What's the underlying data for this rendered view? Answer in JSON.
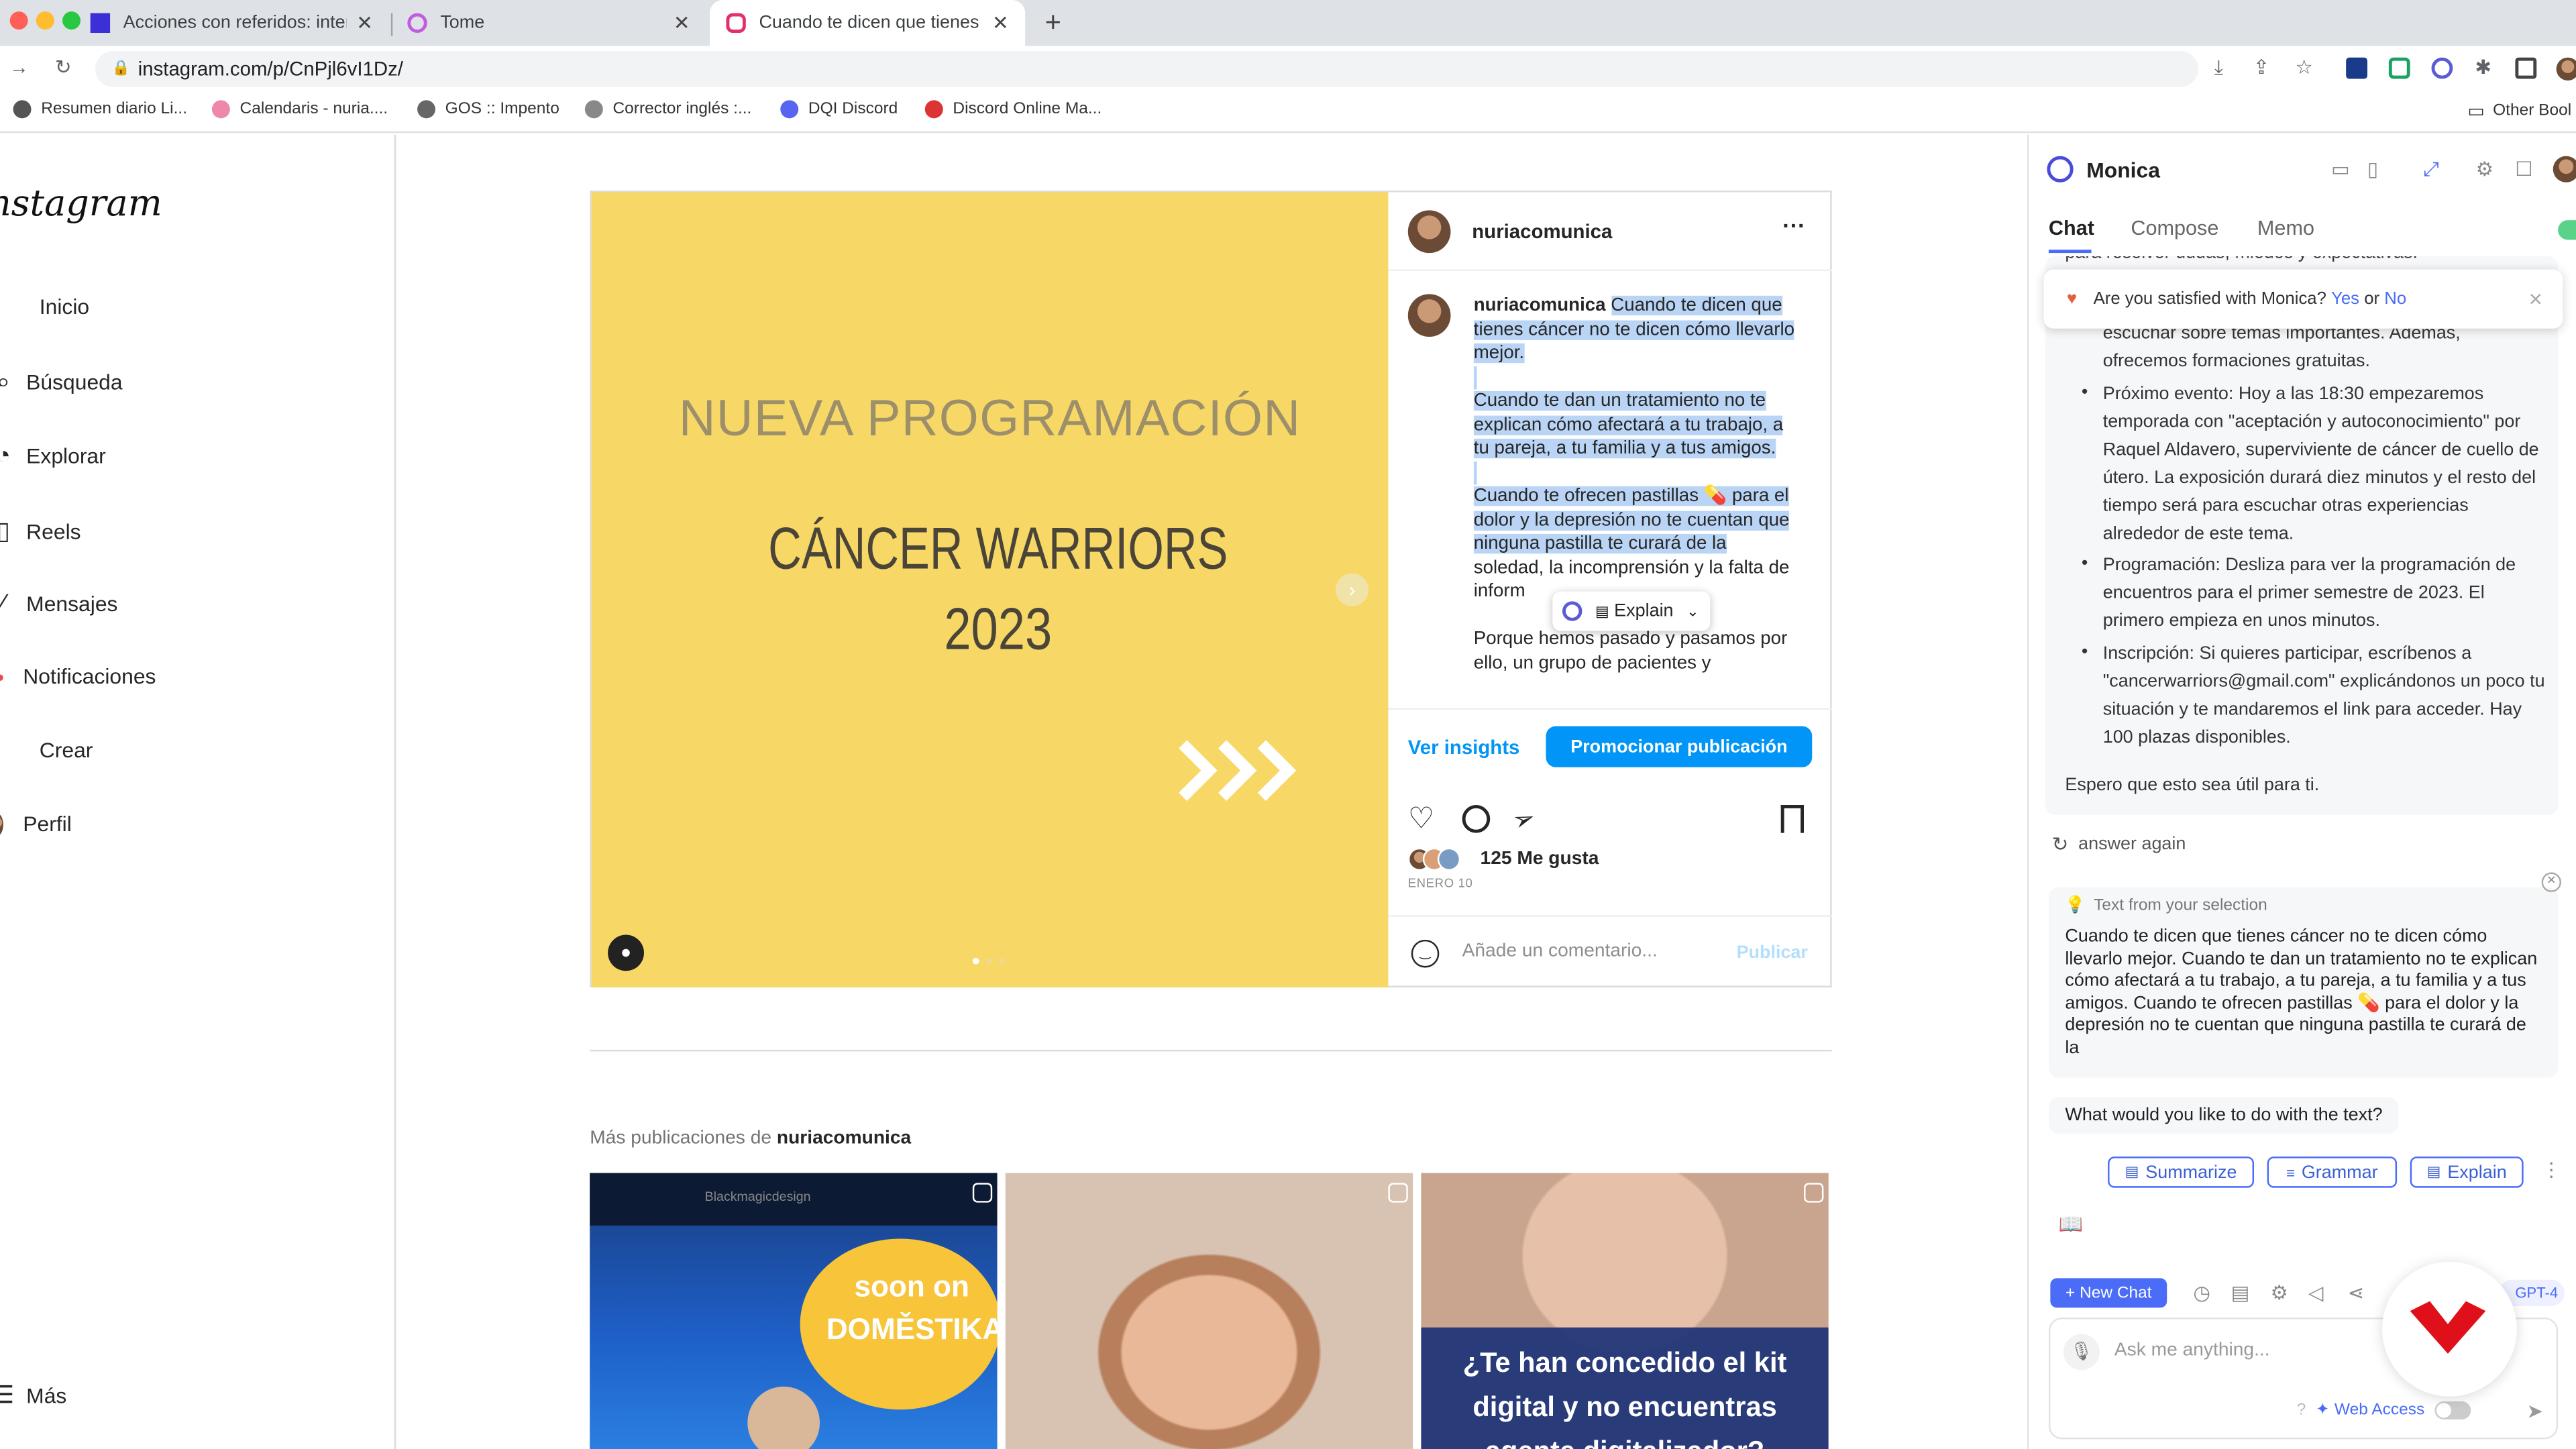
{
  "browser": {
    "tabs": [
      {
        "title": "Acciones con referidos: interca",
        "favicon_color": "#3b2fd6"
      },
      {
        "title": "Tome",
        "favicon_color": "#c05de0"
      },
      {
        "title": "Cuando te dicen que tienes cá",
        "favicon_color": "#e1306c"
      }
    ],
    "new_tab": "+",
    "url": "instagram.com/p/CnPjl6vI1Dz/",
    "bookmarks": [
      "Resumen diario Li...",
      "Calendaris - nuria....",
      "GOS :: Impento",
      "Corrector inglés :...",
      "DQI Discord",
      "Discord Online Ma..."
    ],
    "other_bookmarks": "Other Bool"
  },
  "instagram": {
    "logo": "Instagram",
    "nav": [
      "Inicio",
      "Búsqueda",
      "Explorar",
      "Reels",
      "Mensajes",
      "Notificaciones",
      "Crear",
      "Perfil"
    ],
    "more": "Más",
    "post": {
      "media_line1": "NUEVA PROGRAMACIÓN",
      "media_line2": "CÁNCER WARRIORS",
      "media_line3": "2023",
      "username": "nuriacomunica",
      "more_btn": "···",
      "caption_user": "nuriacomunica",
      "caption_p1": "Cuando te dicen que tienes cáncer no te dicen cómo llevarlo mejor.",
      "caption_p2": "Cuando te dan un tratamiento no te explican cómo afectará a tu trabajo, a tu pareja, a tu familia y a tus amigos.",
      "caption_p3a": "Cuando te ofrecen pastillas 💊 para el dolor y la depresión no te cuentan que ninguna pastilla te curará de la",
      "caption_p3b": "soledad, la incomprensión y la falta de inform",
      "caption_p4": "Porque hemos pasado y pasamos por ello, un grupo de pacientes y",
      "explain_popup": "Explain",
      "insights": "Ver insights",
      "promote": "Promocionar publicación",
      "likes": "125 Me gusta",
      "date": "ENERO 10",
      "comment_placeholder": "Añade un comentario...",
      "publish": "Publicar"
    },
    "more_posts_prefix": "Más publicaciones de ",
    "more_posts_user": "nuriacomunica",
    "thumb1_text": "soon on DOMĚSTIKA",
    "thumb1_brand": "Blackmagicdesign",
    "thumb3_text": "¿Te han concedido el kit digital y no encuentras agente digitalizador?"
  },
  "monica": {
    "title": "Monica",
    "tabs": [
      "Chat",
      "Compose",
      "Memo"
    ],
    "satisfaction": {
      "question": "Are you satisfied with Monica?",
      "yes": "Yes",
      "or": "or",
      "no": "No"
    },
    "frag_top": "para resolver dudas, miedos y expectativas.",
    "frag_1": "escuchar sobre temas importantes. Además,",
    "frag_2": "ofrecemos formaciones gratuitas.",
    "bullets": [
      "Próximo evento: Hoy a las 18:30 empezaremos temporada con \"aceptación y autoconocimiento\" por Raquel Aldavero, superviviente de cáncer de cuello de útero. La exposición durará diez minutos y el resto del tiempo será para escuchar otras experiencias alrededor de este tema.",
      "Programación: Desliza para ver la programación de encuentros para el primer semestre de 2023. El primero empieza en unos minutos.",
      "Inscripción: Si quieres participar, escríbenos a \"cancerwarriors@gmail.com\" explicándonos un poco tu situación y te mandaremos el link para acceder. Hay 100 plazas disponibles."
    ],
    "closing": "Espero que esto sea útil para ti.",
    "answer_again": "answer again",
    "selection_label": "Text from your selection",
    "selection_text": "Cuando te dicen que tienes cáncer no te dicen cómo llevarlo mejor. Cuando te dan un tratamiento no te explican cómo afectará a tu trabajo, a tu pareja, a tu familia y a tus amigos. Cuando te ofrecen pastillas 💊 para el dolor y la depresión no te cuentan que ninguna pastilla te curará de la",
    "prompt_question": "What would you like to do with the text?",
    "actions": [
      "Summarize",
      "Grammar",
      "Explain"
    ],
    "new_chat": "+ New Chat",
    "model": "GPT-4",
    "input_placeholder": "Ask me anything...",
    "web_access": "Web Access"
  }
}
